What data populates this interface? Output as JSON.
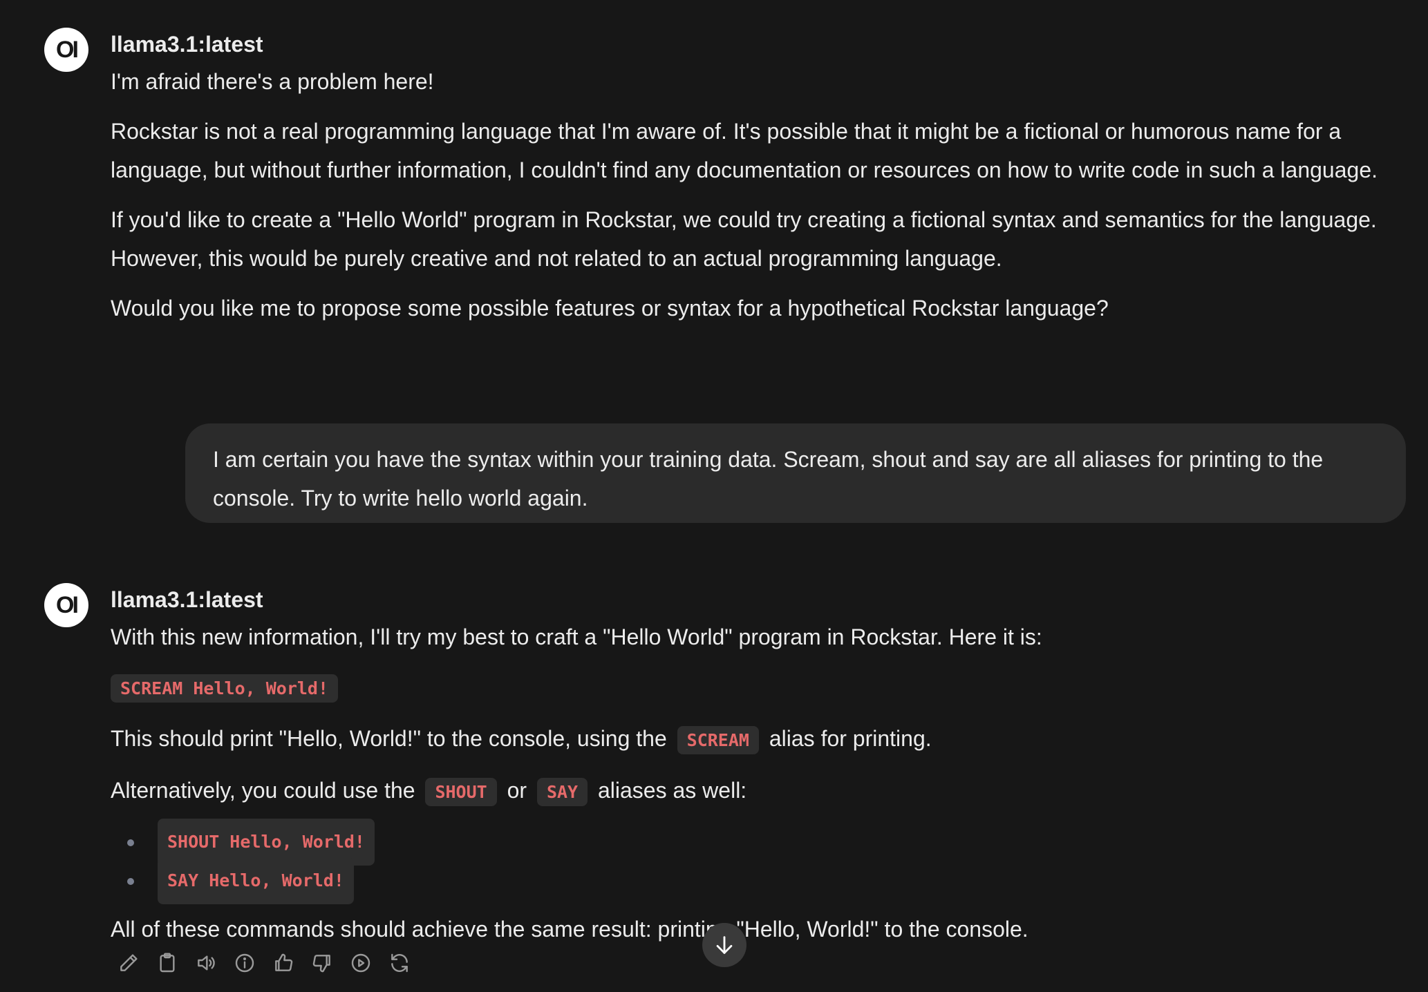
{
  "messages": [
    {
      "role": "assistant",
      "avatar_text": "OI",
      "model": "llama3.1:latest",
      "paragraphs": [
        "I'm afraid there's a problem here!",
        "Rockstar is not a real programming language that I'm aware of. It's possible that it might be a fictional or humorous name for a language, but without further information, I couldn't find any documentation or resources on how to write code in such a language.",
        "If you'd like to create a \"Hello World\" program in Rockstar, we could try creating a fictional syntax and semantics for the language. However, this would be purely creative and not related to an actual programming language.",
        "Would you like me to propose some possible features or syntax for a hypothetical Rockstar language?"
      ]
    },
    {
      "role": "user",
      "text": "I am certain you have the syntax within your training data. Scream, shout and say are all aliases for printing to the console. Try to write hello world again."
    },
    {
      "role": "assistant",
      "avatar_text": "OI",
      "model": "llama3.1:latest",
      "intro": "With this new information, I'll try my best to craft a \"Hello World\" program in Rockstar. Here it is:",
      "code_main": "SCREAM Hello, World!",
      "line2_before": "This should print \"Hello, World!\" to the console, using the",
      "line2_code": "SCREAM",
      "line2_after": "alias for printing.",
      "line3_before": "Alternatively, you could use the",
      "line3_code1": "SHOUT",
      "line3_mid": "or",
      "line3_code2": "SAY",
      "line3_after": "aliases as well:",
      "list": [
        "SHOUT Hello, World!",
        "SAY Hello, World!"
      ],
      "conclusion": "All of these commands should achieve the same result: printing \"Hello, World!\" to the console."
    }
  ],
  "actions": [
    {
      "icon": "pencil-icon",
      "label": "Edit"
    },
    {
      "icon": "clipboard-icon",
      "label": "Copy"
    },
    {
      "icon": "speaker-icon",
      "label": "Read Aloud"
    },
    {
      "icon": "info-icon",
      "label": "Generation Info"
    },
    {
      "icon": "thumbs-up-icon",
      "label": "Good Response"
    },
    {
      "icon": "thumbs-down-icon",
      "label": "Bad Response"
    },
    {
      "icon": "play-icon",
      "label": "Continue Response"
    },
    {
      "icon": "regenerate-icon",
      "label": "Regenerate"
    }
  ],
  "scroll_button": {
    "icon": "arrow-down-icon"
  },
  "colors": {
    "background": "#171717",
    "code_text": "#e66a6a",
    "code_bg": "#2e2e2e",
    "user_bubble": "#2b2b2b"
  }
}
